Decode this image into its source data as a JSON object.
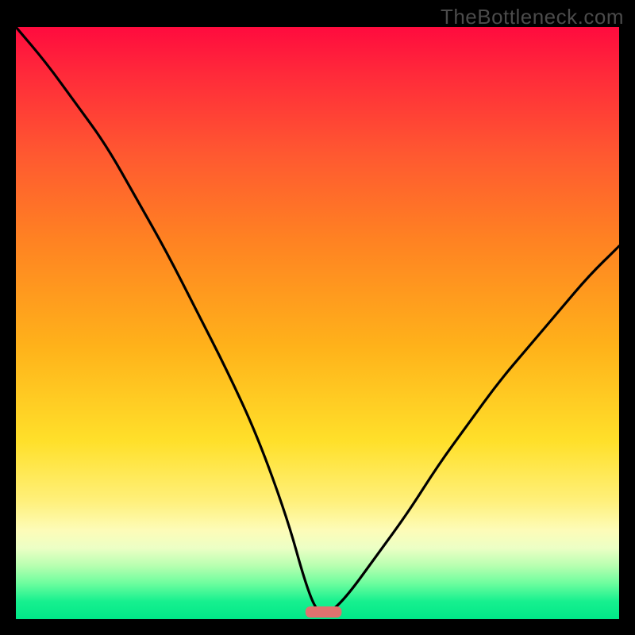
{
  "watermark": "TheBottleneck.com",
  "chart_data": {
    "type": "line",
    "title": "",
    "xlabel": "",
    "ylabel": "",
    "xlim": [
      0,
      100
    ],
    "ylim": [
      0,
      100
    ],
    "series": [
      {
        "name": "bottleneck-curve",
        "x": [
          0,
          5,
          10,
          15,
          20,
          25,
          30,
          35,
          40,
          45,
          48,
          50,
          52,
          55,
          60,
          65,
          70,
          75,
          80,
          85,
          90,
          95,
          100
        ],
        "values": [
          100,
          94,
          87,
          80,
          71,
          62,
          52,
          42,
          31,
          17,
          6,
          1,
          1,
          4,
          11,
          18,
          26,
          33,
          40,
          46,
          52,
          58,
          63
        ]
      }
    ],
    "annotations": [
      {
        "name": "sweet-spot-bar",
        "x_range": [
          48,
          54
        ],
        "y": 0
      }
    ],
    "background": "vertical-heat-gradient"
  },
  "colors": {
    "curve": "#000000",
    "sweet_spot": "#e0726f",
    "frame": "#000000"
  }
}
